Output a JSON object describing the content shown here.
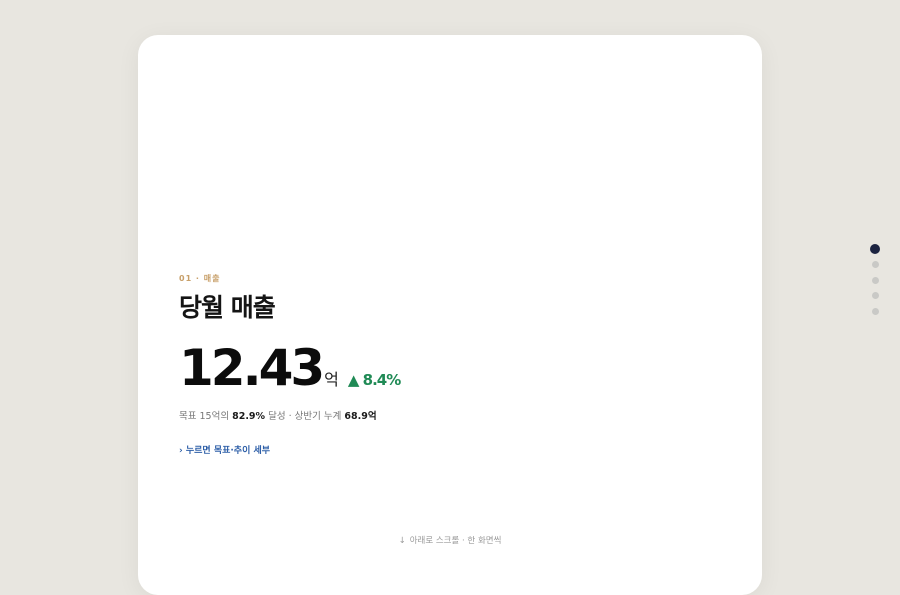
{
  "slide": {
    "eyebrow": "01 · 매출",
    "title": "당월 매출",
    "metric": {
      "value": "12.43",
      "unit": "억",
      "delta": "▲ 8.4%"
    },
    "summary": {
      "prefix": "목표 15억의 ",
      "achieved_pct": "82.9%",
      "middle": " 달성 · 상반기 누계 ",
      "cumulative": "68.9억"
    },
    "detail_link": "› 누르면 목표·추이 세부"
  },
  "scroll_hint": {
    "arrow": "↓",
    "text": "아래로 스크롤 · 한 화면씩"
  },
  "pagination": {
    "count": 5,
    "active_index": 0,
    "active_color": "#1b2340",
    "inactive_color": "#c9c9c6"
  },
  "colors": {
    "background": "#e8e6e0",
    "eyebrow": "#c8a06a",
    "delta_up": "#1f8a55",
    "link": "#2e5fa8"
  }
}
